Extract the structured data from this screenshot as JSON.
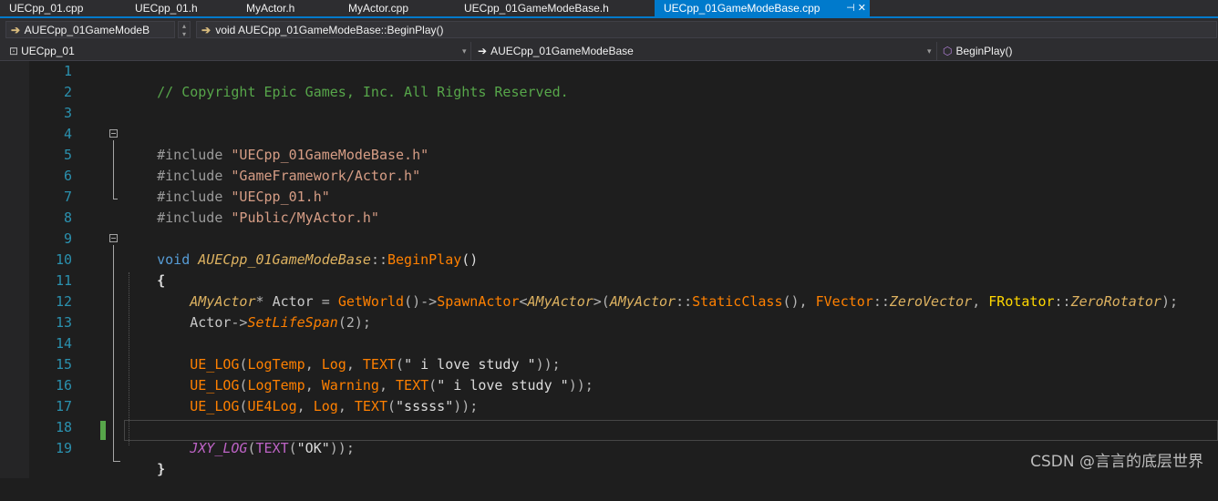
{
  "tabs": [
    {
      "label": "UECpp_01.cpp",
      "active": false
    },
    {
      "label": "UECpp_01.h",
      "active": false
    },
    {
      "label": "MyActor.h",
      "active": false
    },
    {
      "label": "MyActor.cpp",
      "active": false
    },
    {
      "label": "UECpp_01GameModeBase.h",
      "active": false
    },
    {
      "label": "UECpp_01GameModeBase.cpp",
      "active": true
    }
  ],
  "tab_controls": "⊣ ✕",
  "nav": {
    "class_scope": "AUECpp_01GameModeB",
    "member": "void AUECpp_01GameModeBase::BeginPlay()",
    "project": "UECpp_01",
    "class": "AUECpp_01GameModeBase",
    "function": "BeginPlay()",
    "arrow_glyph": "➔",
    "project_icon": "⊡",
    "function_icon": "⬡",
    "dropdown_glyph": "▾"
  },
  "code": {
    "l1": {
      "comment": "// Copyright Epic Games, Inc. All Rights Reserved."
    },
    "l4": {
      "pp": "#include",
      "sp": " ",
      "str": "\"UECpp_01GameModeBase.h\""
    },
    "l5": {
      "pp": "#include",
      "sp": " ",
      "str": "\"GameFramework/Actor.h\""
    },
    "l6": {
      "pp": "#include",
      "sp": " ",
      "str": "\"UECpp_01.h\""
    },
    "l7": {
      "pp": "#include",
      "sp": " ",
      "str": "\"Public/MyActor.h\""
    },
    "l9": {
      "kw": "void",
      "sp": " ",
      "cls": "AUECpp_01GameModeBase",
      "scope": "::",
      "fn": "BeginPlay",
      "paren": "()"
    },
    "l10": {
      "brace": "{"
    },
    "l11": {
      "indent": "    ",
      "t1": "AMyActor",
      "t2": "* ",
      "t3": "Actor",
      "t4": " = ",
      "t5": "GetWorld",
      "t6": "()->",
      "t7": "SpawnActor",
      "t8": "<",
      "t9": "AMyActor",
      "t10": ">(",
      "t11": "AMyActor",
      "t12": "::",
      "t13": "StaticClass",
      "t14": "(), ",
      "t15": "FVector",
      "t16": "::",
      "t17": "ZeroVector",
      "t18": ", ",
      "t19": "FRotator",
      "t20": "::",
      "t21": "ZeroRotator",
      "t22": ");"
    },
    "l12": {
      "indent": "    ",
      "t1": "Actor",
      "t2": "->",
      "t3": "SetLifeSpan",
      "t4": "(2);"
    },
    "l14": {
      "indent": "    ",
      "t1": "UE_LOG",
      "t2": "(",
      "t3": "LogTemp",
      "t4": ", ",
      "t5": "Log",
      "t6": ", ",
      "t7": "TEXT",
      "t8": "(",
      "t9": "\" i love study \"",
      "t10": "));"
    },
    "l15": {
      "indent": "    ",
      "t1": "UE_LOG",
      "t2": "(",
      "t3": "LogTemp",
      "t4": ", ",
      "t5": "Warning",
      "t6": ", ",
      "t7": "TEXT",
      "t8": "(",
      "t9": "\" i love study \"",
      "t10": "));"
    },
    "l16": {
      "indent": "    ",
      "t1": "UE_LOG",
      "t2": "(",
      "t3": "UE4Log",
      "t4": ", ",
      "t5": "Log",
      "t6": ", ",
      "t7": "TEXT",
      "t8": "(",
      "t9": "\"sssss\"",
      "t10": "));"
    },
    "l18": {
      "indent": "    ",
      "t1": "JXY_LOG",
      "t2": "(",
      "t3": "TEXT",
      "t4": "(",
      "t5": "\"OK\"",
      "t6": "));"
    },
    "l19": {
      "brace": "}"
    }
  },
  "line_numbers": [
    "1",
    "2",
    "3",
    "4",
    "5",
    "6",
    "7",
    "8",
    "9",
    "10",
    "11",
    "12",
    "13",
    "14",
    "15",
    "16",
    "17",
    "18",
    "19"
  ],
  "watermark": "CSDN @言言的底层世界"
}
